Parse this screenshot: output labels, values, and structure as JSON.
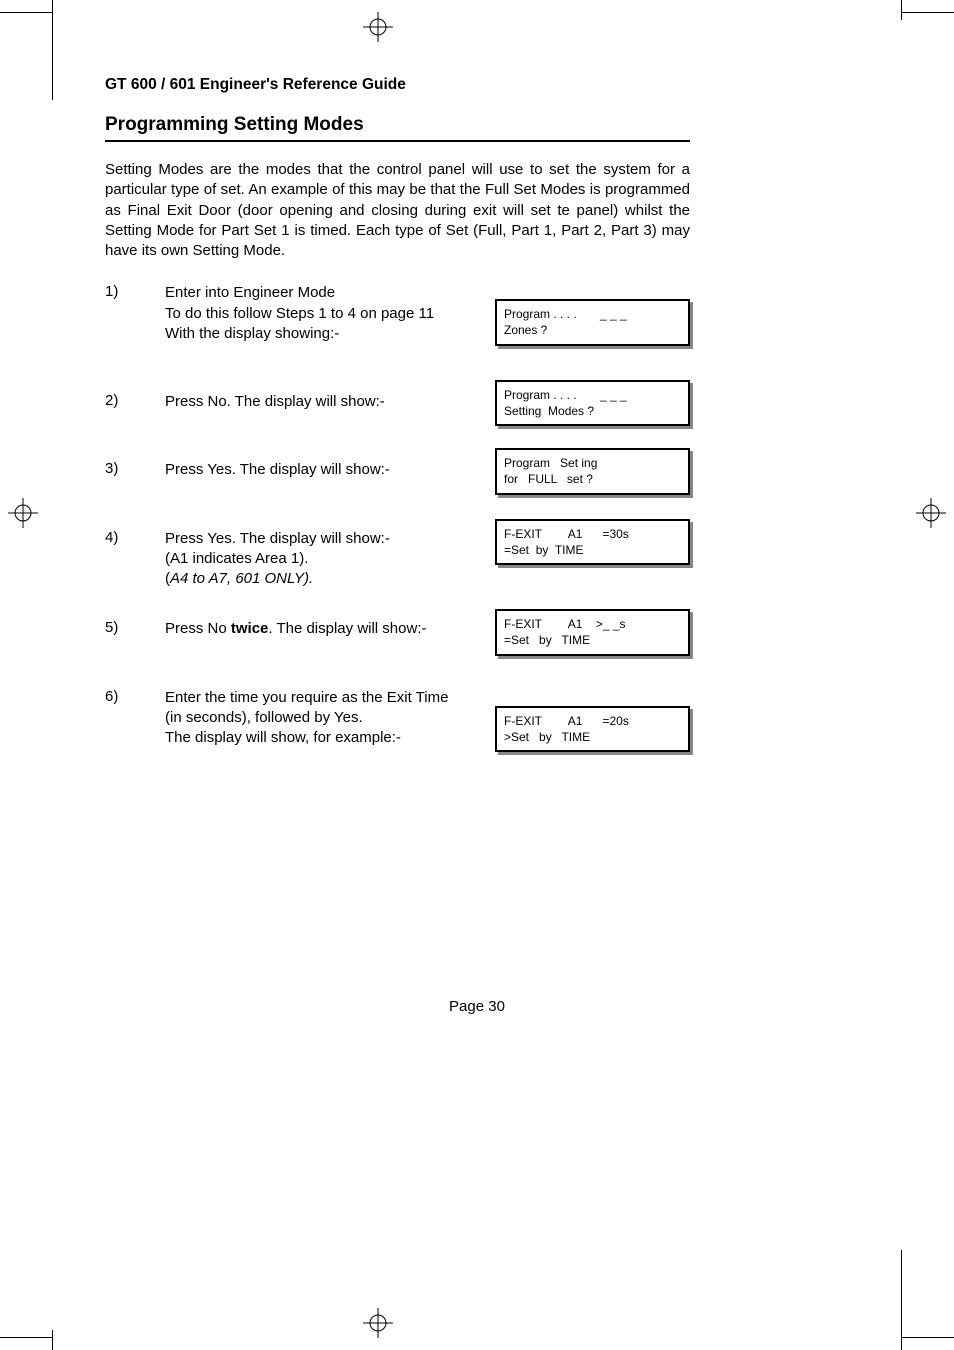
{
  "header": "GT 600 / 601 Engineer's Reference Guide",
  "heading": "Programming Setting Modes",
  "intro": "Setting Modes are the modes that the control panel will use to set the system for a particular type of set. An example of this may be that the Full Set Modes is programmed as Final Exit Door (door opening and closing during exit will set te panel) whilst the Setting Mode for Part Set 1 is timed. Each type of Set (Full, Part 1, Part 2, Part 3) may have its own Setting Mode.",
  "steps": {
    "s1": {
      "num": "1)",
      "line1": "Enter into Engineer Mode",
      "line2": "To do this follow Steps 1 to 4 on page 11",
      "line3": "With the display showing:-",
      "lcd": "Program . . . .       _ _ _\nZones ?"
    },
    "s2": {
      "num": "2)",
      "line1": "Press No. The display will show:-",
      "lcd": "Program . . . .       _ _ _\nSetting  Modes ?"
    },
    "s3": {
      "num": "3)",
      "line1": "Press Yes. The display will show:-",
      "lcd": "Program   Set ing\nfor   FULL   set ?"
    },
    "s4": {
      "num": "4)",
      "line1": "Press Yes. The display will show:-",
      "line2": "(A1 indicates Area 1).",
      "line3_open": "(",
      "line3_italic": "A4 to A7, 601 ONLY).",
      "lcd": "F-EXIT        A1      =30s\n=Set  by  TIME"
    },
    "s5": {
      "num": "5)",
      "line1_a": "Press No ",
      "line1_bold": "twice",
      "line1_b": ". The display will show:-",
      "lcd": "F-EXIT        A1    >_ _s\n=Set   by   TIME"
    },
    "s6": {
      "num": "6)",
      "line1": "Enter the time you require as the Exit Time",
      "line2": "(in seconds), followed by Yes.",
      "line3": "The display will show, for example:-",
      "lcd": "F-EXIT        A1      =20s\n>Set   by   TIME"
    }
  },
  "page_label": "Page  30"
}
